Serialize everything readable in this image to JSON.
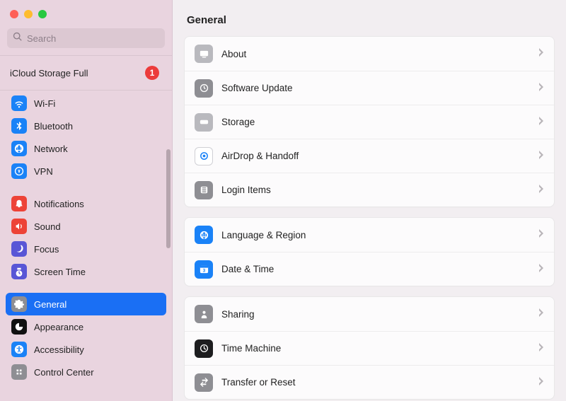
{
  "search": {
    "placeholder": "Search"
  },
  "notice": {
    "text": "iCloud Storage Full",
    "badge": "1"
  },
  "sidebar": {
    "items": [
      {
        "id": "wifi",
        "label": "Wi-Fi"
      },
      {
        "id": "bluetooth",
        "label": "Bluetooth"
      },
      {
        "id": "network",
        "label": "Network"
      },
      {
        "id": "vpn",
        "label": "VPN"
      },
      {
        "id": "notifications",
        "label": "Notifications"
      },
      {
        "id": "sound",
        "label": "Sound"
      },
      {
        "id": "focus",
        "label": "Focus"
      },
      {
        "id": "screentime",
        "label": "Screen Time"
      },
      {
        "id": "general",
        "label": "General"
      },
      {
        "id": "appearance",
        "label": "Appearance"
      },
      {
        "id": "accessibility",
        "label": "Accessibility"
      },
      {
        "id": "controlcenter",
        "label": "Control Center"
      }
    ]
  },
  "page": {
    "title": "General"
  },
  "groups": [
    {
      "rows": [
        {
          "id": "about",
          "label": "About"
        },
        {
          "id": "swupdate",
          "label": "Software Update"
        },
        {
          "id": "storage",
          "label": "Storage"
        },
        {
          "id": "airdrop",
          "label": "AirDrop & Handoff"
        },
        {
          "id": "login",
          "label": "Login Items"
        }
      ]
    },
    {
      "rows": [
        {
          "id": "language",
          "label": "Language & Region"
        },
        {
          "id": "datetime",
          "label": "Date & Time"
        }
      ]
    },
    {
      "rows": [
        {
          "id": "sharing",
          "label": "Sharing"
        },
        {
          "id": "timemach",
          "label": "Time Machine"
        },
        {
          "id": "transfer",
          "label": "Transfer or Reset"
        }
      ]
    }
  ]
}
